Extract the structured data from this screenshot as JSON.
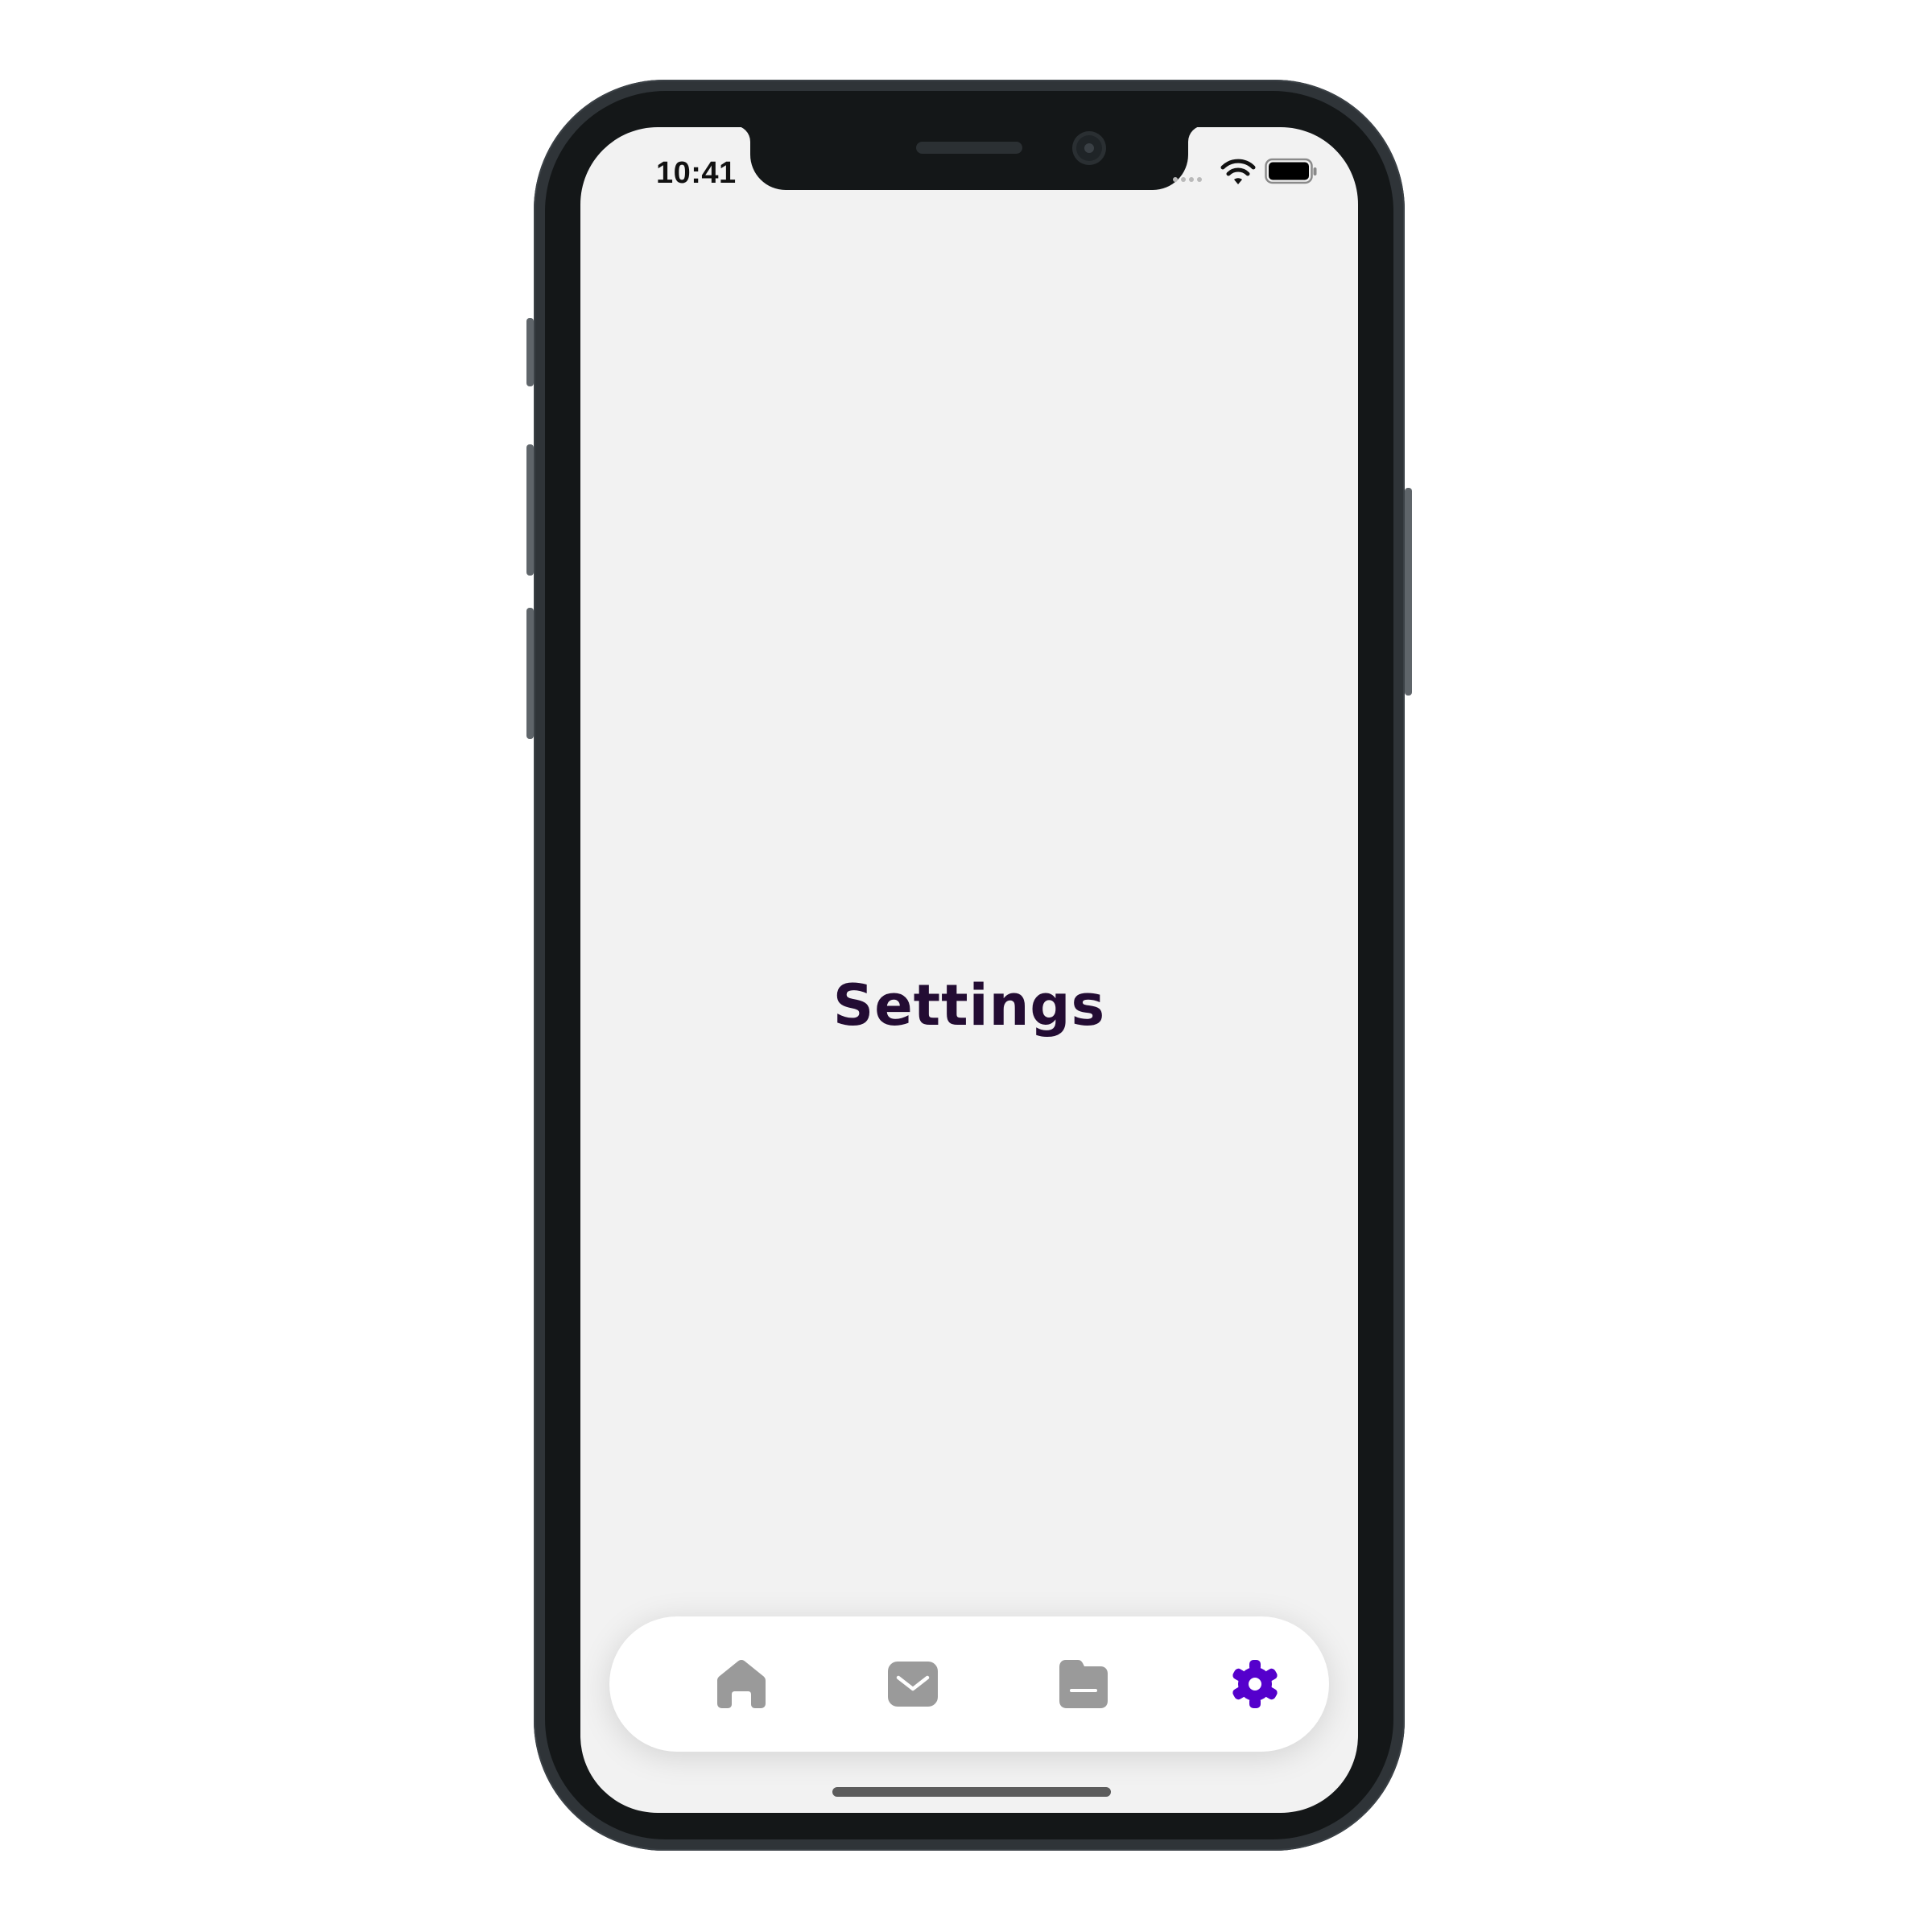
{
  "status_bar": {
    "time": "10:41",
    "wifi_icon": "wifi-icon",
    "battery_icon": "battery-icon",
    "signal_icon": "cellular-signal-icon"
  },
  "main": {
    "title": "Settings"
  },
  "tab_bar": {
    "items": [
      {
        "icon": "home-icon",
        "active": false
      },
      {
        "icon": "inbox-icon",
        "active": false
      },
      {
        "icon": "folder-icon",
        "active": false
      },
      {
        "icon": "gear-icon",
        "active": true
      }
    ],
    "active_color": "#5500cc",
    "inactive_color": "#a0a0a0"
  },
  "colors": {
    "screen_background": "#f2f2f2",
    "title_color": "#230c33",
    "frame_color": "#141718"
  }
}
